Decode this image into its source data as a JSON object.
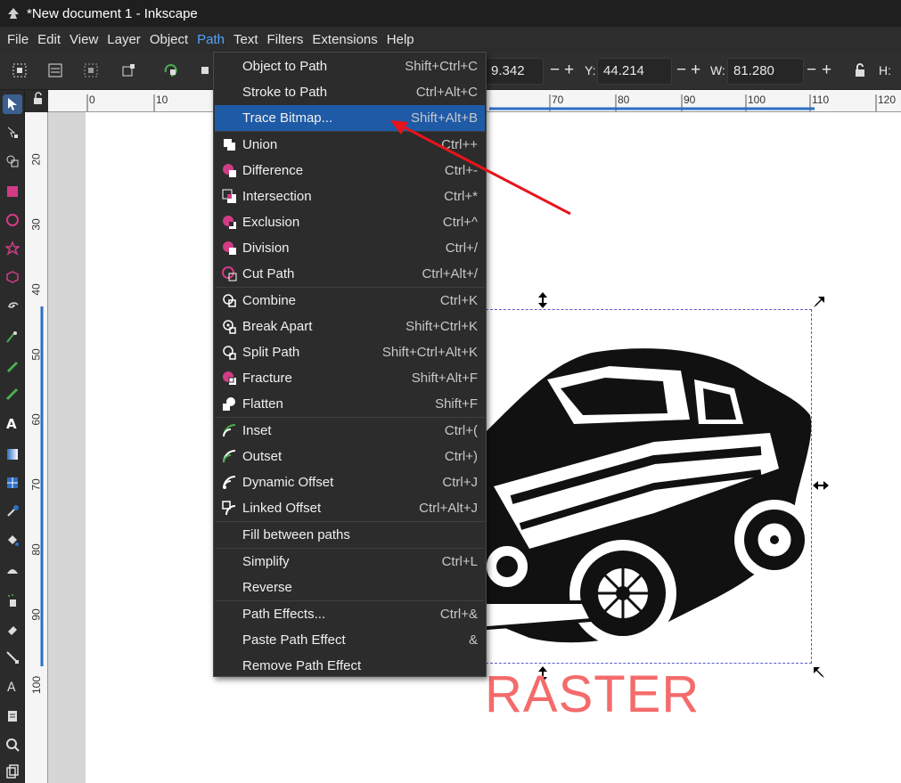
{
  "window": {
    "title": "*New document 1 - Inkscape"
  },
  "menubar": [
    {
      "label": "File"
    },
    {
      "label": "Edit"
    },
    {
      "label": "View"
    },
    {
      "label": "Layer"
    },
    {
      "label": "Object"
    },
    {
      "label": "Path"
    },
    {
      "label": "Text"
    },
    {
      "label": "Filters"
    },
    {
      "label": "Extensions"
    },
    {
      "label": "Help"
    }
  ],
  "toolcontrols": {
    "x_value": "9.342",
    "y_label": "Y:",
    "y_value": "44.214",
    "w_label": "W:",
    "w_value": "81.280",
    "h_label": "H:"
  },
  "ruler_top": [
    "0",
    "10",
    "70",
    "80",
    "90",
    "100",
    "110",
    "120"
  ],
  "ruler_left": [
    "20",
    "30",
    "40",
    "50",
    "60",
    "70",
    "80",
    "90",
    "100"
  ],
  "canvas": {
    "raster_label": "RASTER"
  },
  "path_menu": {
    "items": [
      {
        "label": "Object to Path",
        "accel": "Shift+Ctrl+C",
        "icon": "none"
      },
      {
        "label": "Stroke to Path",
        "accel": "Ctrl+Alt+C",
        "icon": "none"
      },
      {
        "label": "Trace Bitmap...",
        "accel": "Shift+Alt+B",
        "icon": "none"
      },
      {
        "label": "Union",
        "accel": "Ctrl++",
        "icon": "union-icon"
      },
      {
        "label": "Difference",
        "accel": "Ctrl+-",
        "icon": "difference-icon"
      },
      {
        "label": "Intersection",
        "accel": "Ctrl+*",
        "icon": "intersection-icon"
      },
      {
        "label": "Exclusion",
        "accel": "Ctrl+^",
        "icon": "exclusion-icon"
      },
      {
        "label": "Division",
        "accel": "Ctrl+/",
        "icon": "division-icon"
      },
      {
        "label": "Cut Path",
        "accel": "Ctrl+Alt+/",
        "icon": "cut-path-icon"
      },
      {
        "label": "Combine",
        "accel": "Ctrl+K",
        "icon": "combine-icon"
      },
      {
        "label": "Break Apart",
        "accel": "Shift+Ctrl+K",
        "icon": "break-apart-icon"
      },
      {
        "label": "Split Path",
        "accel": "Shift+Ctrl+Alt+K",
        "icon": "split-path-icon"
      },
      {
        "label": "Fracture",
        "accel": "Shift+Alt+F",
        "icon": "fracture-icon"
      },
      {
        "label": "Flatten",
        "accel": "Shift+F",
        "icon": "flatten-icon"
      },
      {
        "label": "Inset",
        "accel": "Ctrl+(",
        "icon": "inset-icon"
      },
      {
        "label": "Outset",
        "accel": "Ctrl+)",
        "icon": "outset-icon"
      },
      {
        "label": "Dynamic Offset",
        "accel": "Ctrl+J",
        "icon": "dynamic-offset-icon"
      },
      {
        "label": "Linked Offset",
        "accel": "Ctrl+Alt+J",
        "icon": "linked-offset-icon"
      },
      {
        "label": "Fill between paths",
        "accel": "",
        "icon": "none"
      },
      {
        "label": "Simplify",
        "accel": "Ctrl+L",
        "icon": "none"
      },
      {
        "label": "Reverse",
        "accel": "",
        "icon": "none"
      },
      {
        "label": "Path Effects...",
        "accel": "Ctrl+&",
        "icon": "none"
      },
      {
        "label": "Paste Path Effect",
        "accel": "&",
        "icon": "none"
      },
      {
        "label": "Remove Path Effect",
        "accel": "",
        "icon": "none"
      }
    ]
  },
  "colors": {
    "highlight": "#1f5aa6",
    "active_menu": "#4ea1ff",
    "raster_text": "#f46b6b",
    "annotation_arrow": "#e8141b",
    "boolean_icon_accent": "#d23c86"
  }
}
